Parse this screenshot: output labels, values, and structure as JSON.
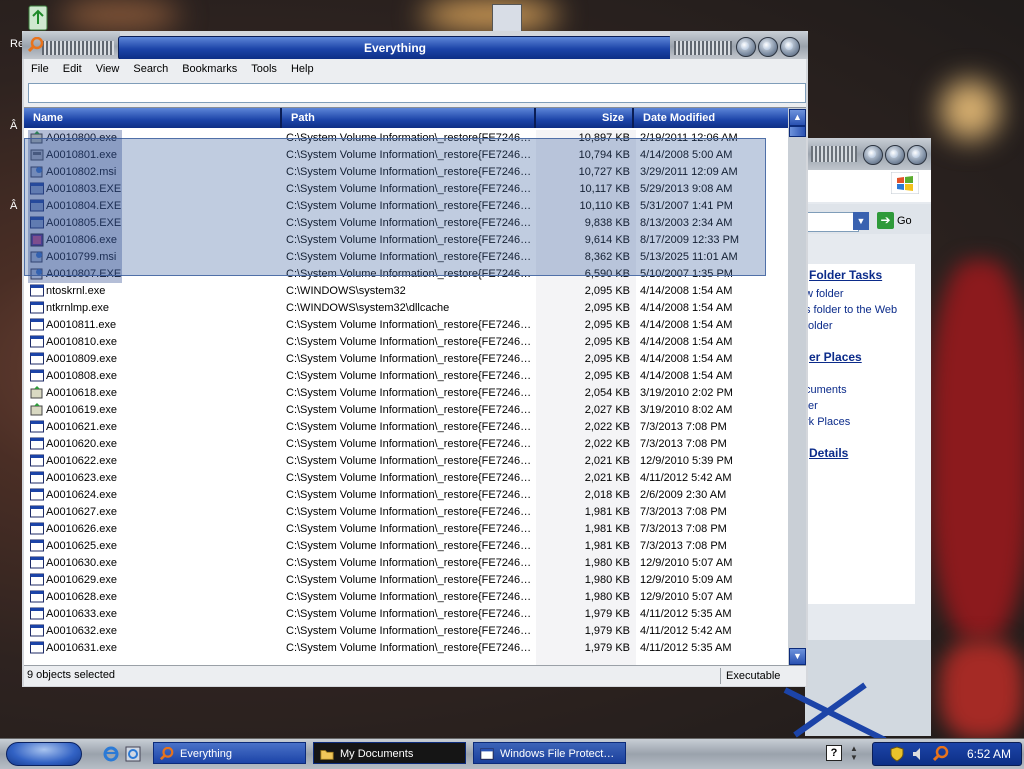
{
  "desktop": {
    "recycle_label": "Re",
    "icon2_label": "Â",
    "icon3_label": "Â"
  },
  "everything": {
    "title": "Everything",
    "menu": [
      "File",
      "Edit",
      "View",
      "Search",
      "Bookmarks",
      "Tools",
      "Help"
    ],
    "search_value": "",
    "columns": {
      "name": "Name",
      "path": "Path",
      "size": "Size",
      "date": "Date Modified"
    },
    "rows": [
      {
        "name": "A0010800.exe",
        "path": "C:\\System Volume Information\\_restore{FE7246…",
        "size": "10,897 KB",
        "date": "2/19/2011 12:06 AM",
        "icon": "setup-icon"
      },
      {
        "name": "A0010801.exe",
        "path": "C:\\System Volume Information\\_restore{FE7246…",
        "size": "10,794 KB",
        "date": "4/14/2008 5:00 AM",
        "icon": "installer-icon"
      },
      {
        "name": "A0010802.msi",
        "path": "C:\\System Volume Information\\_restore{FE7246…",
        "size": "10,727 KB",
        "date": "3/29/2011 12:09 AM",
        "icon": "msi-icon"
      },
      {
        "name": "A0010803.EXE",
        "path": "C:\\System Volume Information\\_restore{FE7246…",
        "size": "10,117 KB",
        "date": "5/29/2013 9:08 AM",
        "icon": "window-icon"
      },
      {
        "name": "A0010804.EXE",
        "path": "C:\\System Volume Information\\_restore{FE7246…",
        "size": "10,110 KB",
        "date": "5/31/2007 1:41 PM",
        "icon": "window-icon"
      },
      {
        "name": "A0010805.EXE",
        "path": "C:\\System Volume Information\\_restore{FE7246…",
        "size": "9,838 KB",
        "date": "8/13/2003 2:34 AM",
        "icon": "window-icon"
      },
      {
        "name": "A0010806.exe",
        "path": "C:\\System Volume Information\\_restore{FE7246…",
        "size": "9,614 KB",
        "date": "8/17/2009 12:33 PM",
        "icon": "app-icon"
      },
      {
        "name": "A0010799.msi",
        "path": "C:\\System Volume Information\\_restore{FE7246…",
        "size": "8,362 KB",
        "date": "5/13/2025 11:01 AM",
        "icon": "msi-icon"
      },
      {
        "name": "A0010807.EXE",
        "path": "C:\\System Volume Information\\_restore{FE7246…",
        "size": "6,590 KB",
        "date": "5/10/2007 1:35 PM",
        "icon": "msi-icon"
      },
      {
        "name": "ntoskrnl.exe",
        "path": "C:\\WINDOWS\\system32",
        "size": "2,095 KB",
        "date": "4/14/2008 1:54 AM",
        "icon": "exe-icon"
      },
      {
        "name": "ntkrnlmp.exe",
        "path": "C:\\WINDOWS\\system32\\dllcache",
        "size": "2,095 KB",
        "date": "4/14/2008 1:54 AM",
        "icon": "exe-icon"
      },
      {
        "name": "A0010811.exe",
        "path": "C:\\System Volume Information\\_restore{FE7246…",
        "size": "2,095 KB",
        "date": "4/14/2008 1:54 AM",
        "icon": "exe-icon"
      },
      {
        "name": "A0010810.exe",
        "path": "C:\\System Volume Information\\_restore{FE7246…",
        "size": "2,095 KB",
        "date": "4/14/2008 1:54 AM",
        "icon": "exe-icon"
      },
      {
        "name": "A0010809.exe",
        "path": "C:\\System Volume Information\\_restore{FE7246…",
        "size": "2,095 KB",
        "date": "4/14/2008 1:54 AM",
        "icon": "exe-icon"
      },
      {
        "name": "A0010808.exe",
        "path": "C:\\System Volume Information\\_restore{FE7246…",
        "size": "2,095 KB",
        "date": "4/14/2008 1:54 AM",
        "icon": "exe-icon"
      },
      {
        "name": "A0010618.exe",
        "path": "C:\\System Volume Information\\_restore{FE7246…",
        "size": "2,054 KB",
        "date": "3/19/2010 2:02 PM",
        "icon": "setup-icon"
      },
      {
        "name": "A0010619.exe",
        "path": "C:\\System Volume Information\\_restore{FE7246…",
        "size": "2,027 KB",
        "date": "3/19/2010 8:02 AM",
        "icon": "setup-icon"
      },
      {
        "name": "A0010621.exe",
        "path": "C:\\System Volume Information\\_restore{FE7246…",
        "size": "2,022 KB",
        "date": "7/3/2013 7:08 PM",
        "icon": "exe-icon"
      },
      {
        "name": "A0010620.exe",
        "path": "C:\\System Volume Information\\_restore{FE7246…",
        "size": "2,022 KB",
        "date": "7/3/2013 7:08 PM",
        "icon": "exe-icon"
      },
      {
        "name": "A0010622.exe",
        "path": "C:\\System Volume Information\\_restore{FE7246…",
        "size": "2,021 KB",
        "date": "12/9/2010 5:39 PM",
        "icon": "exe-icon"
      },
      {
        "name": "A0010623.exe",
        "path": "C:\\System Volume Information\\_restore{FE7246…",
        "size": "2,021 KB",
        "date": "4/11/2012 5:42 AM",
        "icon": "exe-icon"
      },
      {
        "name": "A0010624.exe",
        "path": "C:\\System Volume Information\\_restore{FE7246…",
        "size": "2,018 KB",
        "date": "2/6/2009 2:30 AM",
        "icon": "exe-icon"
      },
      {
        "name": "A0010627.exe",
        "path": "C:\\System Volume Information\\_restore{FE7246…",
        "size": "1,981 KB",
        "date": "7/3/2013 7:08 PM",
        "icon": "exe-icon"
      },
      {
        "name": "A0010626.exe",
        "path": "C:\\System Volume Information\\_restore{FE7246…",
        "size": "1,981 KB",
        "date": "7/3/2013 7:08 PM",
        "icon": "exe-icon"
      },
      {
        "name": "A0010625.exe",
        "path": "C:\\System Volume Information\\_restore{FE7246…",
        "size": "1,981 KB",
        "date": "7/3/2013 7:08 PM",
        "icon": "exe-icon"
      },
      {
        "name": "A0010630.exe",
        "path": "C:\\System Volume Information\\_restore{FE7246…",
        "size": "1,980 KB",
        "date": "12/9/2010 5:07 AM",
        "icon": "exe-icon"
      },
      {
        "name": "A0010629.exe",
        "path": "C:\\System Volume Information\\_restore{FE7246…",
        "size": "1,980 KB",
        "date": "12/9/2010 5:09 AM",
        "icon": "exe-icon"
      },
      {
        "name": "A0010628.exe",
        "path": "C:\\System Volume Information\\_restore{FE7246…",
        "size": "1,980 KB",
        "date": "12/9/2010 5:07 AM",
        "icon": "exe-icon"
      },
      {
        "name": "A0010633.exe",
        "path": "C:\\System Volume Information\\_restore{FE7246…",
        "size": "1,979 KB",
        "date": "4/11/2012 5:35 AM",
        "icon": "exe-icon"
      },
      {
        "name": "A0010632.exe",
        "path": "C:\\System Volume Information\\_restore{FE7246…",
        "size": "1,979 KB",
        "date": "4/11/2012 5:42 AM",
        "icon": "exe-icon"
      },
      {
        "name": "A0010631.exe",
        "path": "C:\\System Volume Information\\_restore{FE7246…",
        "size": "1,979 KB",
        "date": "4/11/2012 5:35 AM",
        "icon": "exe-icon"
      }
    ],
    "selected_count": 9,
    "status_left": "9 objects selected",
    "status_right": "Executable"
  },
  "explorer": {
    "go_label": "Go",
    "folder_tasks": "Folder Tasks",
    "task1": "w folder",
    "task2": "s folder to the Web",
    "task3": "folder",
    "other_places": "er Places",
    "place1": "cuments",
    "place2": "ter",
    "place3": "rk Places",
    "details": "Details"
  },
  "taskbar": {
    "buttons": [
      {
        "label": "Everything",
        "active": true
      },
      {
        "label": "My Documents",
        "active": false
      },
      {
        "label": "Windows File Protect…",
        "active": false
      }
    ],
    "clock": "6:52 AM",
    "help_glyph": "?"
  },
  "colors": {
    "title_blue": "#1c44a8",
    "selection": "#3c5fa0",
    "taskbar_active": "#2a52b2",
    "taskbar_dark": "#111111"
  }
}
